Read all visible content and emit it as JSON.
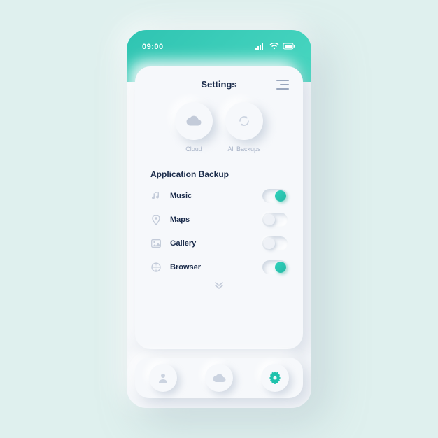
{
  "status": {
    "time": "09:00"
  },
  "header": {
    "title": "Settings"
  },
  "tabs": {
    "cloud": {
      "label": "Cloud"
    },
    "all_backups": {
      "label": "All Backups"
    }
  },
  "section": {
    "title": "Application Backup"
  },
  "apps": [
    {
      "icon": "music-icon",
      "label": "Music",
      "enabled": true
    },
    {
      "icon": "pin-icon",
      "label": "Maps",
      "enabled": false
    },
    {
      "icon": "gallery-icon",
      "label": "Gallery",
      "enabled": false
    },
    {
      "icon": "globe-icon",
      "label": "Browser",
      "enabled": true
    }
  ],
  "nav": {
    "items": [
      {
        "icon": "user-icon",
        "active": false
      },
      {
        "icon": "cloud-icon",
        "active": false
      },
      {
        "icon": "gear-icon",
        "active": true
      }
    ]
  },
  "colors": {
    "accent": "#22c6b0",
    "text": "#1a2b4a",
    "muted": "#c3cbd9"
  }
}
